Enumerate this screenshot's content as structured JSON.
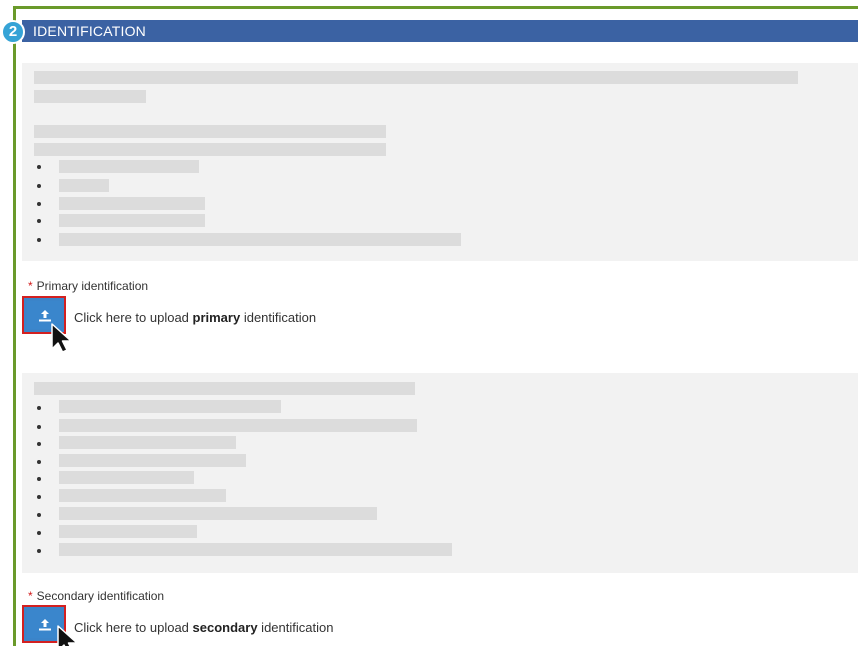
{
  "section": {
    "step_number": "2",
    "title": "IDENTIFICATION"
  },
  "primary": {
    "required_mark": "*",
    "label_bold_word": "Primary",
    "label_rest": " identification",
    "upload_prefix": "Click here to upload ",
    "upload_bold": "primary",
    "upload_suffix": " identification"
  },
  "secondary": {
    "required_mark": "*",
    "label_bold_word": "Secondary",
    "label_rest": " identification",
    "upload_prefix": "Click here to upload ",
    "upload_bold": "secondary",
    "upload_suffix": " identification"
  },
  "icons": {
    "upload": "upload-icon",
    "cursor": "mouse-pointer-icon"
  },
  "colors": {
    "header_bg": "#3b62a3",
    "badge_bg": "#35a3d6",
    "frame_green": "#6a9a2a",
    "button_blue": "#3a86cc",
    "highlight_red": "#d32020",
    "required_red": "#d11a1a"
  }
}
